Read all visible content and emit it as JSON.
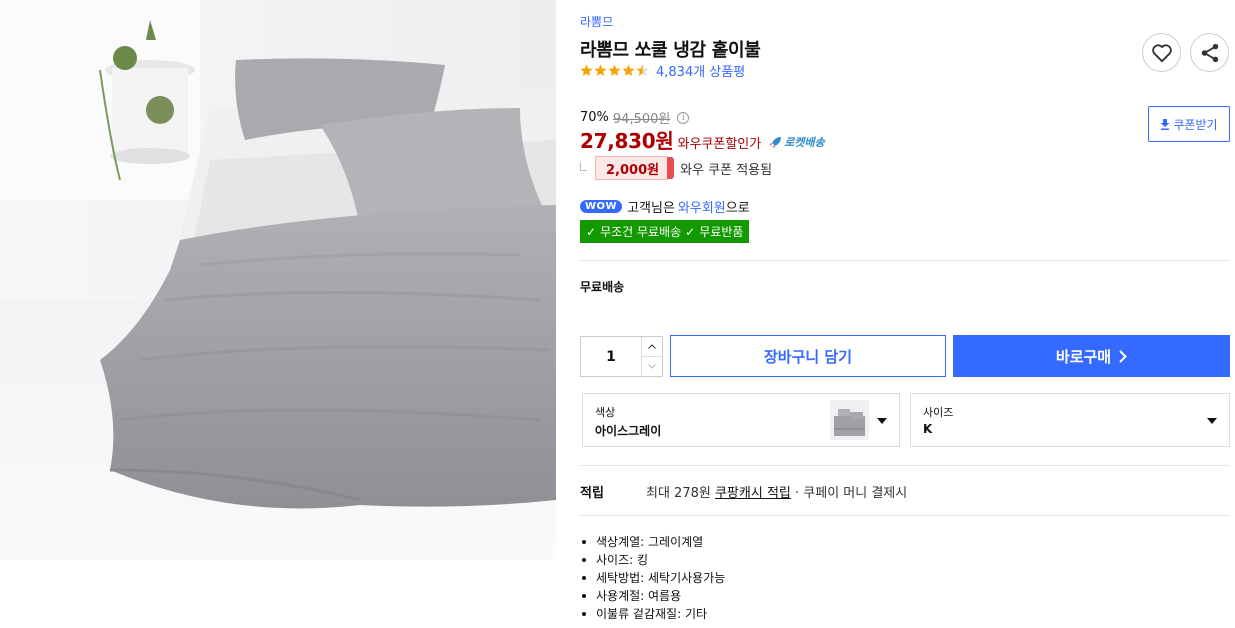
{
  "product": {
    "brand": "라뽐므",
    "title": "라뽐므 쏘쿨 냉감 홑이불",
    "rating": 4.5,
    "review_count": "4,834개 상품평"
  },
  "price": {
    "discount_rate": "70%",
    "original_price": "94,500원",
    "sale_price": "27,830원",
    "wow_label": "와우쿠폰할인가",
    "rocket_label": "로켓배송",
    "coupon_amount": "2,000원",
    "coupon_text": "와우 쿠폰 적용됨",
    "coupon_button": "쿠폰받기"
  },
  "wow": {
    "badge": "WOW",
    "text_prefix": "고객님은",
    "link": "와우회원",
    "text_suffix": "으로",
    "benefit_1": "무조건 무료배송",
    "benefit_2": "무료반품"
  },
  "shipping": {
    "label": "무료배송"
  },
  "purchase": {
    "quantity": "1",
    "cart_button": "장바구니 담기",
    "buy_button": "바로구매"
  },
  "options": {
    "color_label": "색상",
    "color_value": "아이스그레이",
    "size_label": "사이즈",
    "size_value": "K"
  },
  "points": {
    "label": "적립",
    "text_prefix": "최대 278원",
    "link": "쿠팡캐시 적립",
    "text_suffix": "· 쿠페이 머니 결제시"
  },
  "attributes": [
    "색상계열: 그레이계열",
    "사이즈: 킹",
    "세탁방법: 세탁기사용가능",
    "사용계절: 여름용",
    "이불류 겉감재질: 기타"
  ],
  "colors": {
    "accent": "#346aff",
    "sale": "#ae0000",
    "benefit_green": "#129a00",
    "star": "#f6a400"
  }
}
